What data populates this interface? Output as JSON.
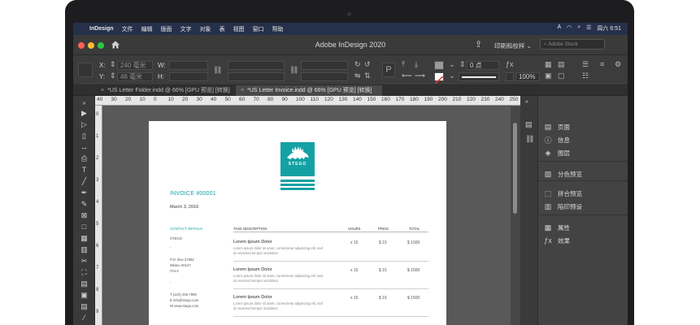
{
  "menubar": {
    "apple": "",
    "app": "InDesign",
    "items": [
      "文件",
      "编辑",
      "版面",
      "文字",
      "对象",
      "表",
      "视图",
      "窗口",
      "帮助"
    ],
    "clock": "周六 6:51",
    "status_icons": [
      "A"
    ]
  },
  "titlebar": {
    "title": "Adobe InDesign 2020",
    "workspace": "印刷和校样 ⌄",
    "search_placeholder": "Adobe Stock"
  },
  "controlbar": {
    "x_label": "X:",
    "y_label": "Y:",
    "x_value": "240 毫米",
    "y_value": "46 毫米",
    "w_label": "W:",
    "h_label": "H:",
    "stroke_value": "0 点",
    "zoom_value": "100%"
  },
  "tabs": [
    {
      "label": "*US Letter Folder.indd @ 66% [GPU 预览] [转换]",
      "active": false
    },
    {
      "label": "*US Letter Invoice.indd @ 66% [GPU 预览] [转换]",
      "active": true
    }
  ],
  "ruler": {
    "h_ticks": [
      "40",
      "30",
      "20",
      "10",
      "0",
      "10",
      "20",
      "30",
      "40",
      "50",
      "60",
      "70",
      "80",
      "90",
      "100",
      "110",
      "120",
      "130",
      "140",
      "150",
      "160",
      "170",
      "180",
      "190",
      "200",
      "210",
      "220",
      "230",
      "240",
      "250"
    ],
    "v_ticks": [
      "0",
      "1",
      "2",
      "3",
      "4",
      "5",
      "6",
      "7",
      "8",
      "9"
    ]
  },
  "document": {
    "logo_text": "STEGO",
    "invoice_title": "INVOICE #00001",
    "date": "March 3, 2016",
    "contact_head": "CONTACT DETAILS",
    "contact_lines": [
      "STEGO",
      "-",
      "P.O. Box 27682",
      "Milano 20147",
      "ITALY",
      "-",
      "T (123) 456 7890",
      "E info@stego.com",
      "W www.stego.com"
    ],
    "headers": {
      "task": "TASK DESCRIPTION",
      "hours": "HOURS",
      "price": "PRICE",
      "total": "TOTAL"
    },
    "rows": [
      {
        "title": "Lorem Ipsum Dolor",
        "desc": "Lorem ipsum dolor sit amet, consectetur adipiscing elit, sed do eiusmod tempor incididunt",
        "hours": "x 15",
        "price": "$ 15",
        "total": "$ 1500"
      },
      {
        "title": "Lorem Ipsum Dolor",
        "desc": "Lorem ipsum dolor sit amet, consectetur adipiscing elit, sed do eiusmod tempor incididunt",
        "hours": "x 15",
        "price": "$ 15",
        "total": "$ 1500"
      },
      {
        "title": "Lorem Ipsum Dolor",
        "desc": "Lorem ipsum dolor sit amet, consectetur adipiscing elit, sed do eiusmod tempor incididunt",
        "hours": "x 15",
        "price": "$ 15",
        "total": "$ 1500"
      }
    ]
  },
  "panels": [
    {
      "label": "页面",
      "icon": "pages-icon"
    },
    {
      "label": "信息",
      "icon": "info-icon"
    },
    {
      "label": "图层",
      "icon": "layers-icon"
    },
    {
      "label": "分色预览",
      "icon": "separations-icon"
    },
    {
      "label": "拼合预览",
      "icon": "flattener-icon"
    },
    {
      "label": "陷印预设",
      "icon": "trap-icon"
    },
    {
      "label": "属性",
      "icon": "properties-icon"
    },
    {
      "label": "效果",
      "icon": "fx-icon"
    }
  ],
  "colors": {
    "accent": "#14a1a3",
    "menubar": "#25304a",
    "ui_dark": "#3a3a3a",
    "pasteboard": "#595959"
  }
}
